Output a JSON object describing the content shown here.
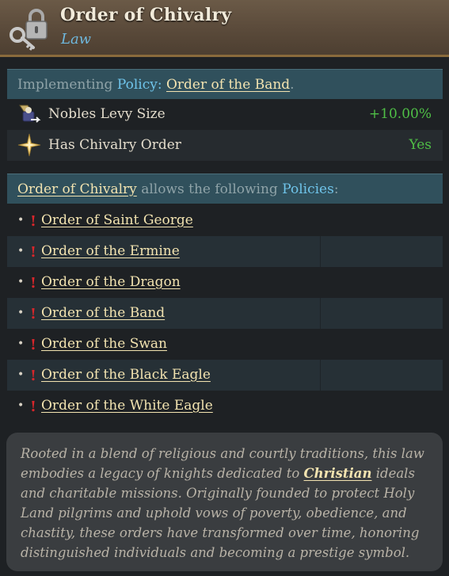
{
  "header": {
    "title": "Order of Chivalry",
    "subtitle": "Law",
    "icon": "key-lock-icon"
  },
  "implementing": {
    "prefix": "Implementing",
    "policy_word": "Policy",
    "colon": ":",
    "policy_name": "Order of the Band",
    "suffix": "."
  },
  "modifiers": [
    {
      "label": "Nobles Levy Size",
      "value": "+10.00%",
      "icon": "nobles-levy-icon"
    },
    {
      "label": "Has Chivalry Order",
      "value": "Yes",
      "icon": "compass-star-icon"
    }
  ],
  "allows": {
    "law_name": "Order of Chivalry",
    "text": "allows the following",
    "policies_word": "Policies",
    "colon": ":"
  },
  "policies": [
    {
      "bullet": "•",
      "warn": "!",
      "name": "Order of Saint George"
    },
    {
      "bullet": "•",
      "warn": "!",
      "name": "Order of the Ermine"
    },
    {
      "bullet": "•",
      "warn": "!",
      "name": "Order of the Dragon"
    },
    {
      "bullet": "•",
      "warn": "!",
      "name": "Order of the Band"
    },
    {
      "bullet": "•",
      "warn": "!",
      "name": "Order of the Swan"
    },
    {
      "bullet": "•",
      "warn": "!",
      "name": "Order of the Black Eagle"
    },
    {
      "bullet": "•",
      "warn": "!",
      "name": "Order of the White Eagle"
    }
  ],
  "description": {
    "part1": "Rooted in a blend of religious and courtly traditions, this law embodies a legacy of knights dedicated to ",
    "link": "Christian",
    "part2": " ideals and charitable missions. Originally founded to protect Holy Land pilgrims and uphold vows of poverty, obedience, and chastity, these orders have transformed over time, honoring distinguished individuals and becoming a prestige symbol."
  },
  "colors": {
    "header_bg": "#5a4a3a",
    "accent_blue": "#6fc4ea",
    "positive_green": "#4fbf46",
    "link_gold": "#f2e3b0",
    "warning_red": "#d8262b",
    "section_bar": "#30505c"
  }
}
